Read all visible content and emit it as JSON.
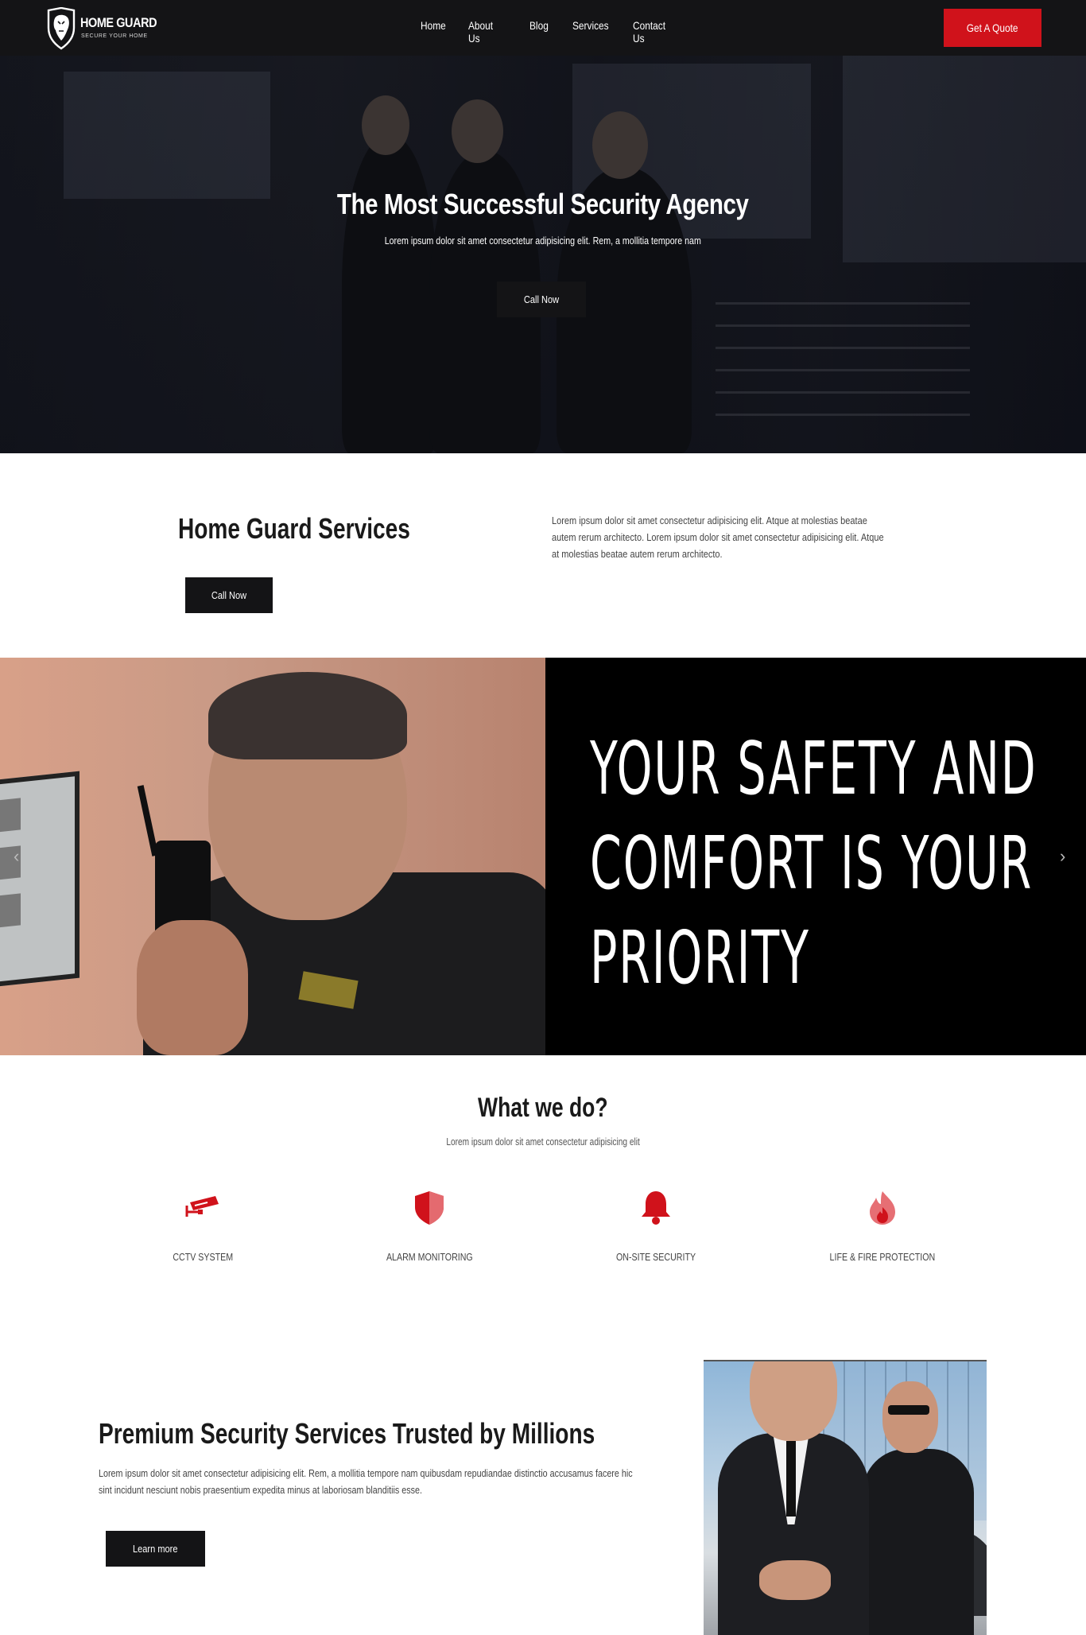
{
  "nav": {
    "brand_name": "HOME GUARD",
    "brand_tagline": "SECURE YOUR HOME",
    "items": [
      "Home",
      "About Us",
      "Blog",
      "Services",
      "Contact Us"
    ],
    "cta": "Get A Quote",
    "cta_color": "#d0121b"
  },
  "hero": {
    "title": "The Most Successful Security Agency",
    "subtitle": "Lorem ipsum dolor sit amet consectetur adipisicing elit. Rem, a mollitia tempore nam",
    "button": "Call Now"
  },
  "services_intro": {
    "title": "Home Guard Services",
    "text": "Lorem ipsum dolor sit amet consectetur adipisicing elit. Atque at molestias beatae autem rerum architecto. Lorem ipsum dolor sit amet consectetur adipisicing elit. Atque at molestias beatae autem rerum architecto.",
    "text_lines": [
      "Lorem ipsum dolor sit amet consectetur adipisicing elit. Atque at molestias beatae",
      "autem rerum architecto. Lorem ipsum dolor sit amet consectetur adipisicing elit. Atque",
      "at molestias beatae autem rerum architecto."
    ],
    "button": "Call Now"
  },
  "slider": {
    "headline_lines": [
      "YOUR SAFETY AND",
      "COMFORT IS YOUR",
      "PRIORITY"
    ],
    "prev_icon": "chevron-left-icon",
    "next_icon": "chevron-right-icon"
  },
  "what_we_do": {
    "title": "What we do?",
    "subtitle": "Lorem ipsum dolor sit amet consectetur adipisicing elit",
    "features": [
      {
        "label": "CCTV SYSTEM",
        "icon": "cctv-camera-icon"
      },
      {
        "label": "ALARM MONITORING",
        "icon": "shield-icon"
      },
      {
        "label": "ON-SITE SECURITY",
        "icon": "bell-icon"
      },
      {
        "label": "LIFE & FIRE PROTECTION",
        "icon": "fire-icon"
      }
    ],
    "icon_color": "#d0121b"
  },
  "premium": {
    "title": "Premium Security Services Trusted by Millions",
    "text_lines": [
      "Lorem ipsum dolor sit amet consectetur adipisicing elit. Rem, a mollitia tempore nam quibusdam repudiandae distinctio accusamus facere hic",
      "sint incidunt nesciunt nobis praesentium expedita minus at laboriosam blanditiis esse."
    ],
    "button": "Learn more"
  }
}
